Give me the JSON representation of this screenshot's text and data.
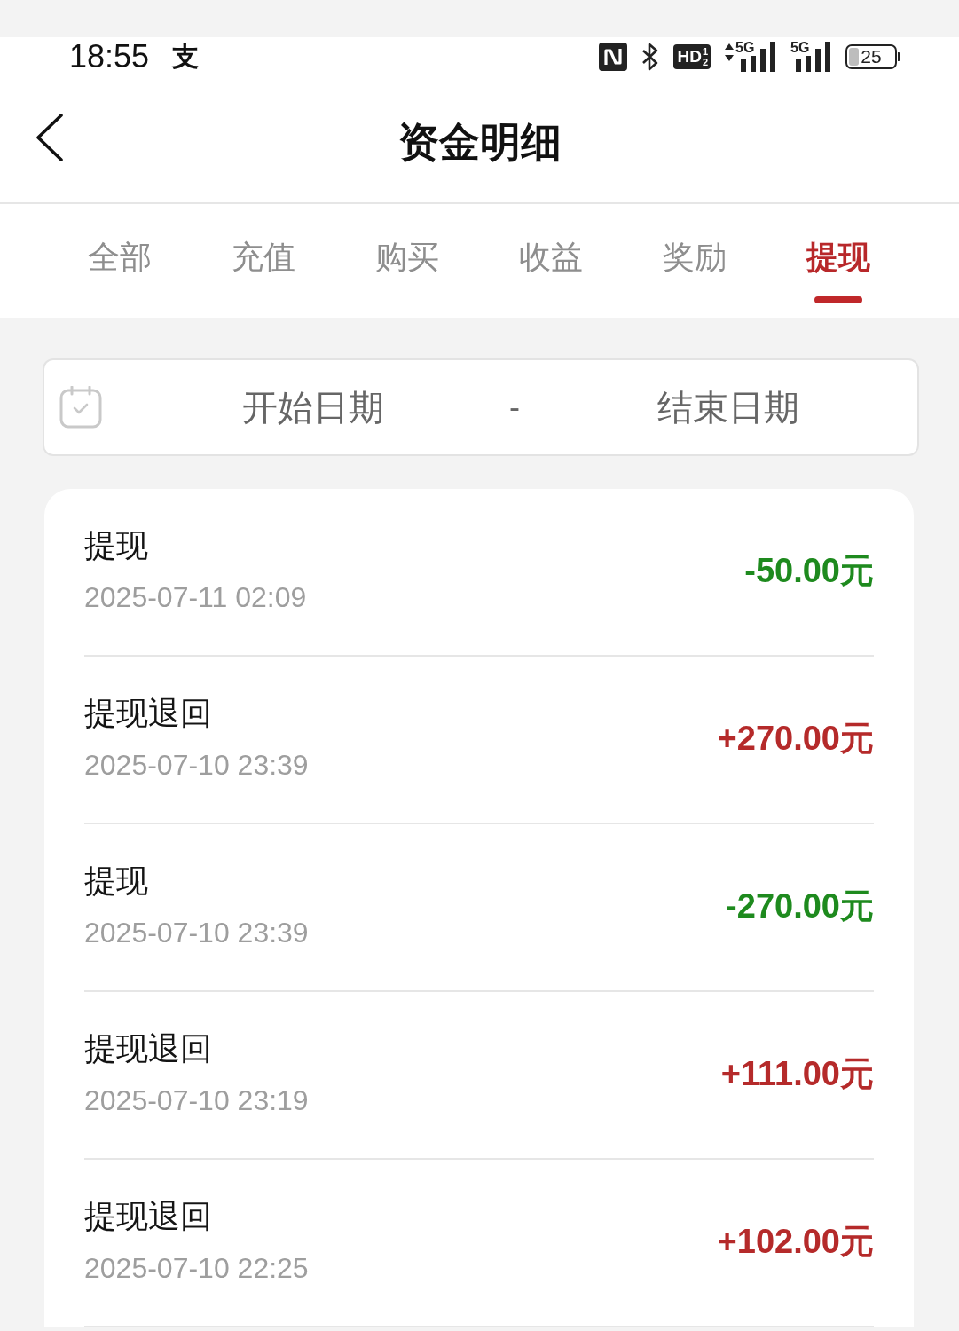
{
  "status_bar": {
    "time": "18:55",
    "app_icon": "支",
    "hd_badge": {
      "text": "HD",
      "sup": "1",
      "sub": "2"
    },
    "signals": [
      {
        "label": "5G",
        "data_arrows": true
      },
      {
        "label": "5G",
        "data_arrows": false
      }
    ],
    "battery": "25"
  },
  "header": {
    "title": "资金明细"
  },
  "tabs": [
    {
      "label": "全部",
      "selected": false
    },
    {
      "label": "充值",
      "selected": false
    },
    {
      "label": "购买",
      "selected": false
    },
    {
      "label": "收益",
      "selected": false
    },
    {
      "label": "奖励",
      "selected": false
    },
    {
      "label": "提现",
      "selected": true
    }
  ],
  "date_filter": {
    "start_placeholder": "开始日期",
    "separator": "-",
    "end_placeholder": "结束日期"
  },
  "transactions": [
    {
      "title": "提现",
      "time": "2025-07-11 02:09",
      "amount": "-50.00元",
      "kind": "debit"
    },
    {
      "title": "提现退回",
      "time": "2025-07-10 23:39",
      "amount": "+270.00元",
      "kind": "credit"
    },
    {
      "title": "提现",
      "time": "2025-07-10 23:39",
      "amount": "-270.00元",
      "kind": "debit"
    },
    {
      "title": "提现退回",
      "time": "2025-07-10 23:19",
      "amount": "+111.00元",
      "kind": "credit"
    },
    {
      "title": "提现退回",
      "time": "2025-07-10 22:25",
      "amount": "+102.00元",
      "kind": "credit"
    }
  ]
}
